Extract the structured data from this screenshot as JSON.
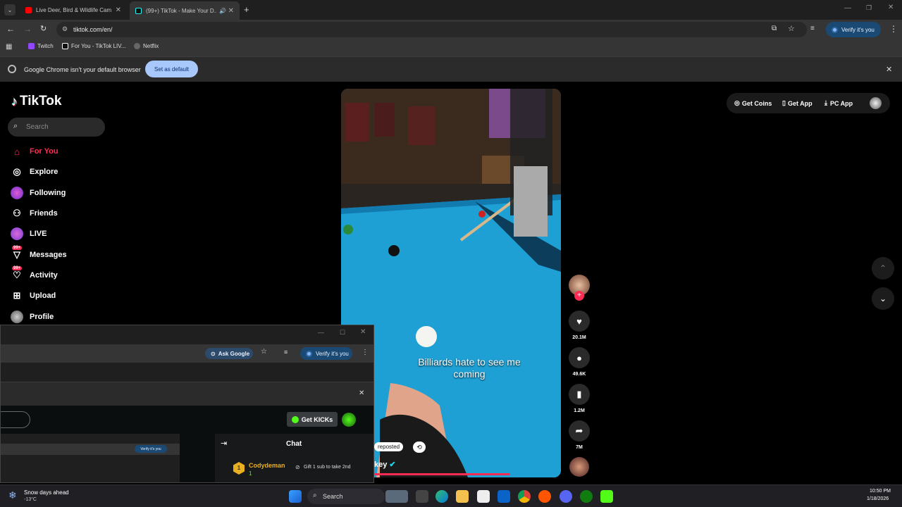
{
  "tabs": [
    {
      "title": "Live Deer, Bird & Wildlife Cam",
      "close": "✕"
    },
    {
      "title": "(99+) TikTok - Make Your D...",
      "close": "✕"
    }
  ],
  "new_tab": "+",
  "address": "tiktok.com/en/",
  "verify_label": "Verify it's you",
  "bookmarks": [
    "Twitch",
    "For You - TikTok LIV...",
    "Netflix"
  ],
  "infobar": {
    "message": "Google Chrome isn't your default browser",
    "button": "Set as default"
  },
  "tiktok": {
    "logo": "TikTok",
    "search_placeholder": "Search",
    "nav": [
      {
        "label": "For You",
        "icon": "home-icon",
        "active": true
      },
      {
        "label": "Explore",
        "icon": "compass-icon"
      },
      {
        "label": "Following",
        "icon": "following-avatar"
      },
      {
        "label": "Friends",
        "icon": "friends-icon"
      },
      {
        "label": "LIVE",
        "icon": "live-icon"
      },
      {
        "label": "Messages",
        "icon": "messages-icon",
        "badge": "99+"
      },
      {
        "label": "Activity",
        "icon": "activity-icon",
        "badge": "99+"
      },
      {
        "label": "Upload",
        "icon": "upload-icon"
      },
      {
        "label": "Profile",
        "icon": "profile-avatar"
      }
    ],
    "top_actions": [
      "Get Coins",
      "Get App",
      "PC App"
    ],
    "video": {
      "caption_line1": "Billiards hate to see me",
      "caption_line2": "coming",
      "reposted": "reposted",
      "author_partial": "key"
    },
    "stats": {
      "likes": "20.1M",
      "comments": "49.6K",
      "saves": "1.2M",
      "shares": "7M"
    }
  },
  "popup": {
    "ask_google": "Ask Google",
    "verify_label": "Verify it's you",
    "get_kicks": "Get KICKs",
    "chat_title": "Chat",
    "chat_user": "Codydeman",
    "chat_user_level": "1",
    "chat_msg": "Gift 1 sub to take 2nd",
    "mini_verify": "Verify it's you"
  },
  "taskbar": {
    "weather_title": "Snow days ahead",
    "weather_temp": "-13°C",
    "search": "Search",
    "time": "10:50 PM",
    "date": "1/18/2026"
  },
  "colors": {
    "accent": "#fe2c55",
    "chrome_blue": "#a8c7fa",
    "pool_table": "#1fa0d4"
  }
}
